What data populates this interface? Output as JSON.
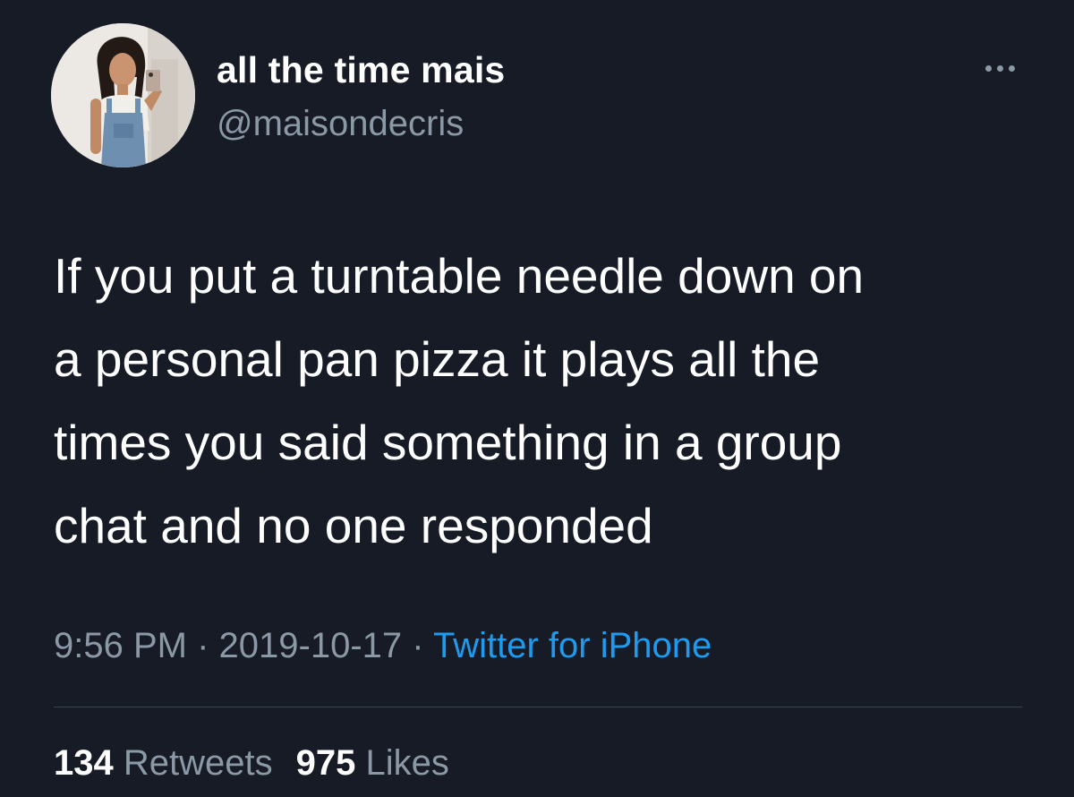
{
  "author": {
    "display_name": "all the time mais",
    "handle": "@maisondecris"
  },
  "tweet": {
    "lines": [
      "If you put a turntable needle down on",
      "a personal pan pizza it plays all the",
      "times you said something in a group",
      "chat and no one responded"
    ],
    "time": "9:56 PM",
    "separator": "·",
    "date": "2019-10-17",
    "source": "Twitter for iPhone"
  },
  "stats": {
    "retweets_count": "134",
    "retweets_label": "Retweets",
    "likes_count": "975",
    "likes_label": "Likes"
  },
  "icons": {
    "more": "more-horizontal-icon"
  },
  "colors": {
    "background": "#161b26",
    "text": "#ffffff",
    "secondary": "#8b98a5",
    "link": "#1d9bf0",
    "divider": "#38444d"
  }
}
